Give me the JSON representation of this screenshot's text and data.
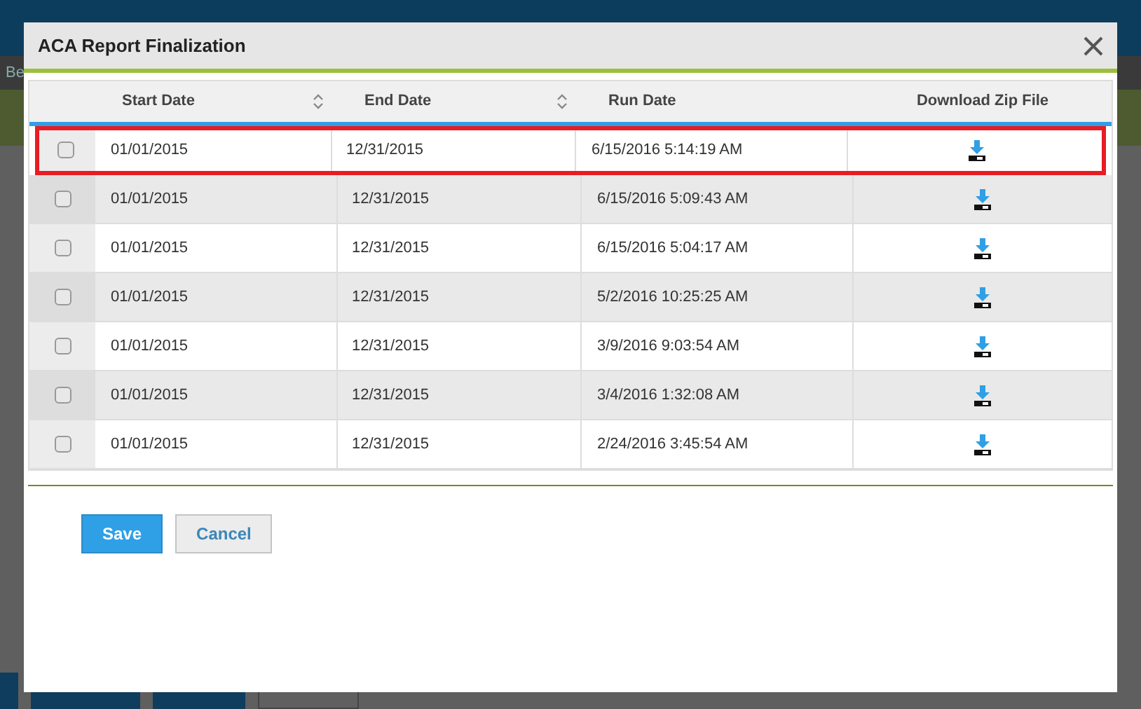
{
  "background": {
    "label": "Be"
  },
  "dialog": {
    "title": "ACA Report Finalization"
  },
  "table": {
    "columns": [
      {
        "label": "Start Date",
        "sortable": true
      },
      {
        "label": "End Date",
        "sortable": true
      },
      {
        "label": "Run Date",
        "sortable": false
      },
      {
        "label": "Download Zip File",
        "sortable": false
      }
    ],
    "rows": [
      {
        "checked": false,
        "selected": true,
        "start": "01/01/2015",
        "end": "12/31/2015",
        "run": "6/15/2016 5:14:19 AM"
      },
      {
        "checked": false,
        "selected": false,
        "start": "01/01/2015",
        "end": "12/31/2015",
        "run": "6/15/2016 5:09:43 AM"
      },
      {
        "checked": false,
        "selected": false,
        "start": "01/01/2015",
        "end": "12/31/2015",
        "run": "6/15/2016 5:04:17 AM"
      },
      {
        "checked": false,
        "selected": false,
        "start": "01/01/2015",
        "end": "12/31/2015",
        "run": "5/2/2016 10:25:25 AM"
      },
      {
        "checked": false,
        "selected": false,
        "start": "01/01/2015",
        "end": "12/31/2015",
        "run": "3/9/2016 9:03:54 AM"
      },
      {
        "checked": false,
        "selected": false,
        "start": "01/01/2015",
        "end": "12/31/2015",
        "run": "3/4/2016 1:32:08 AM"
      },
      {
        "checked": false,
        "selected": false,
        "start": "01/01/2015",
        "end": "12/31/2015",
        "run": "2/24/2016 3:45:54 AM"
      }
    ]
  },
  "buttons": [
    {
      "label": "Save",
      "kind": "primary"
    },
    {
      "label": "Cancel",
      "kind": "secondary"
    }
  ]
}
